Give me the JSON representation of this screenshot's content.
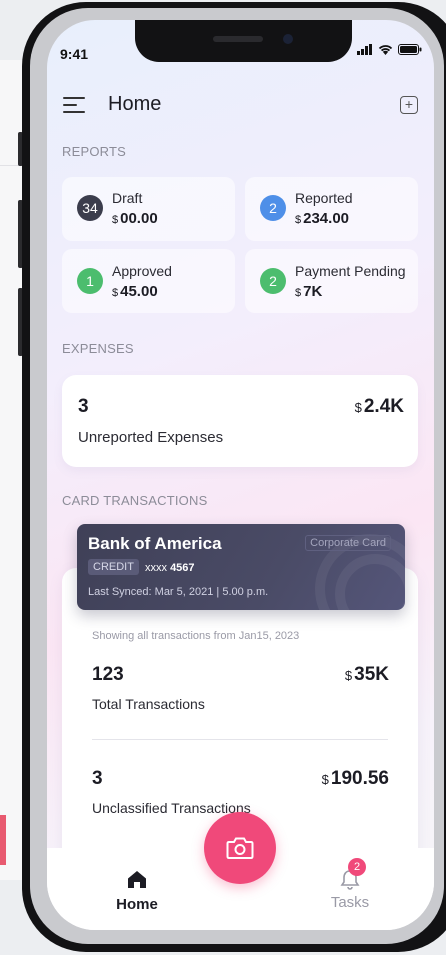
{
  "status_bar": {
    "time": "9:41"
  },
  "header": {
    "title": "Home",
    "add_symbol": "+"
  },
  "sections": {
    "reports": "REPORTS",
    "expenses": "EXPENSES",
    "card_transactions": "CARD TRANSACTIONS"
  },
  "reports": [
    {
      "count": "34",
      "label": "Draft",
      "currency": "$",
      "amount": "00.00",
      "color": "#3b3d4c"
    },
    {
      "count": "2",
      "label": "Reported",
      "currency": "$",
      "amount": "234.00",
      "color": "#4e8fe8"
    },
    {
      "count": "1",
      "label": "Approved",
      "currency": "$",
      "amount": "45.00",
      "color": "#4cbd6e"
    },
    {
      "count": "2",
      "label": "Payment Pending",
      "currency": "$",
      "amount": "7K",
      "color": "#4cbd6e"
    }
  ],
  "expenses": {
    "count": "3",
    "currency": "$",
    "amount": "2.4K",
    "label": "Unreported Expenses"
  },
  "card": {
    "bank": "Bank of America",
    "type": "Corporate Card",
    "kind": "CREDIT",
    "masked": "xxxx",
    "last4": "4567",
    "synced": "Last Synced: Mar 5, 2021 | 5.00 p.m."
  },
  "transactions": {
    "showing": "Showing all transactions from Jan15, 2023",
    "total_count": "123",
    "total_currency": "$",
    "total_amount": "35K",
    "total_label": "Total Transactions",
    "unclassified_count": "3",
    "unclassified_currency": "$",
    "unclassified_amount": "190.56",
    "unclassified_label": "Unclassified Transactions"
  },
  "tabbar": {
    "home": "Home",
    "tasks": "Tasks",
    "tasks_badge": "2"
  },
  "colors": {
    "accent": "#f0497a",
    "card_bg": "#44455f"
  }
}
